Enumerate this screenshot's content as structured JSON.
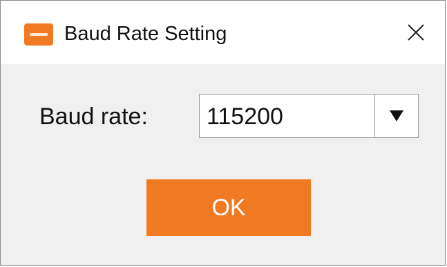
{
  "window": {
    "title": "Baud Rate Setting",
    "app_icon": "app-logo-icon",
    "close_icon": "close-icon"
  },
  "form": {
    "baud_rate_label": "Baud rate:",
    "baud_rate_value": "115200",
    "dropdown_icon": "triangle-down-icon"
  },
  "actions": {
    "ok_label": "OK"
  },
  "colors": {
    "accent": "#f07a22",
    "background": "#f0f0f0",
    "titlebar": "#ffffff"
  }
}
